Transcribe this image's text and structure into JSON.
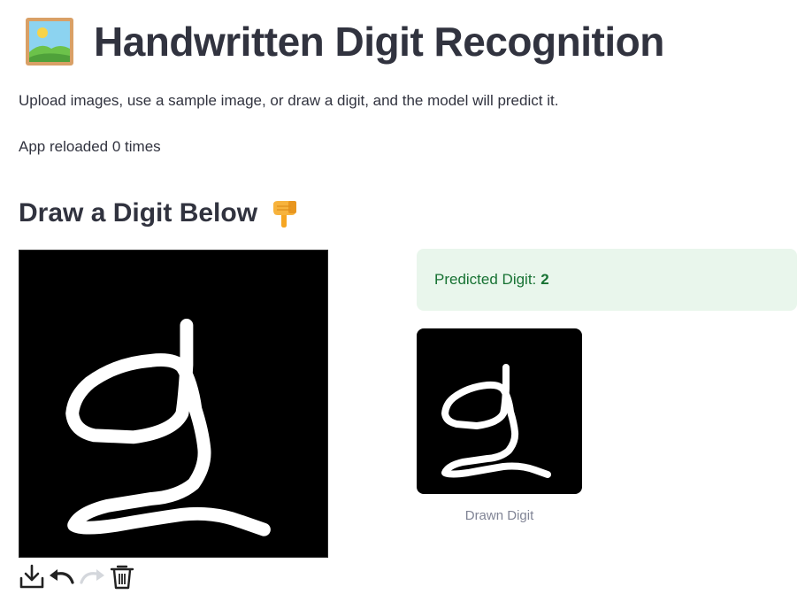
{
  "header": {
    "icon": "framed-picture-icon",
    "title": "Handwritten Digit Recognition"
  },
  "description": "Upload images, use a sample image, or draw a digit, and the model will predict it.",
  "reload_text": "App reloaded 0 times",
  "draw_section": {
    "title": "Draw a Digit Below",
    "icon": "pointing-down-hand-icon",
    "canvas_background": "#000000",
    "stroke_color": "#ffffff",
    "toolbar": [
      {
        "name": "download-icon",
        "enabled": true
      },
      {
        "name": "undo-icon",
        "enabled": true
      },
      {
        "name": "redo-icon",
        "enabled": false
      },
      {
        "name": "trash-icon",
        "enabled": true
      }
    ]
  },
  "prediction": {
    "label": "Predicted Digit:",
    "value": "2",
    "bg_color": "#e9f6ec",
    "text_color": "#177233"
  },
  "drawn_image": {
    "caption": "Drawn Digit"
  },
  "colors": {
    "text": "#31333f",
    "caption": "#808495"
  }
}
